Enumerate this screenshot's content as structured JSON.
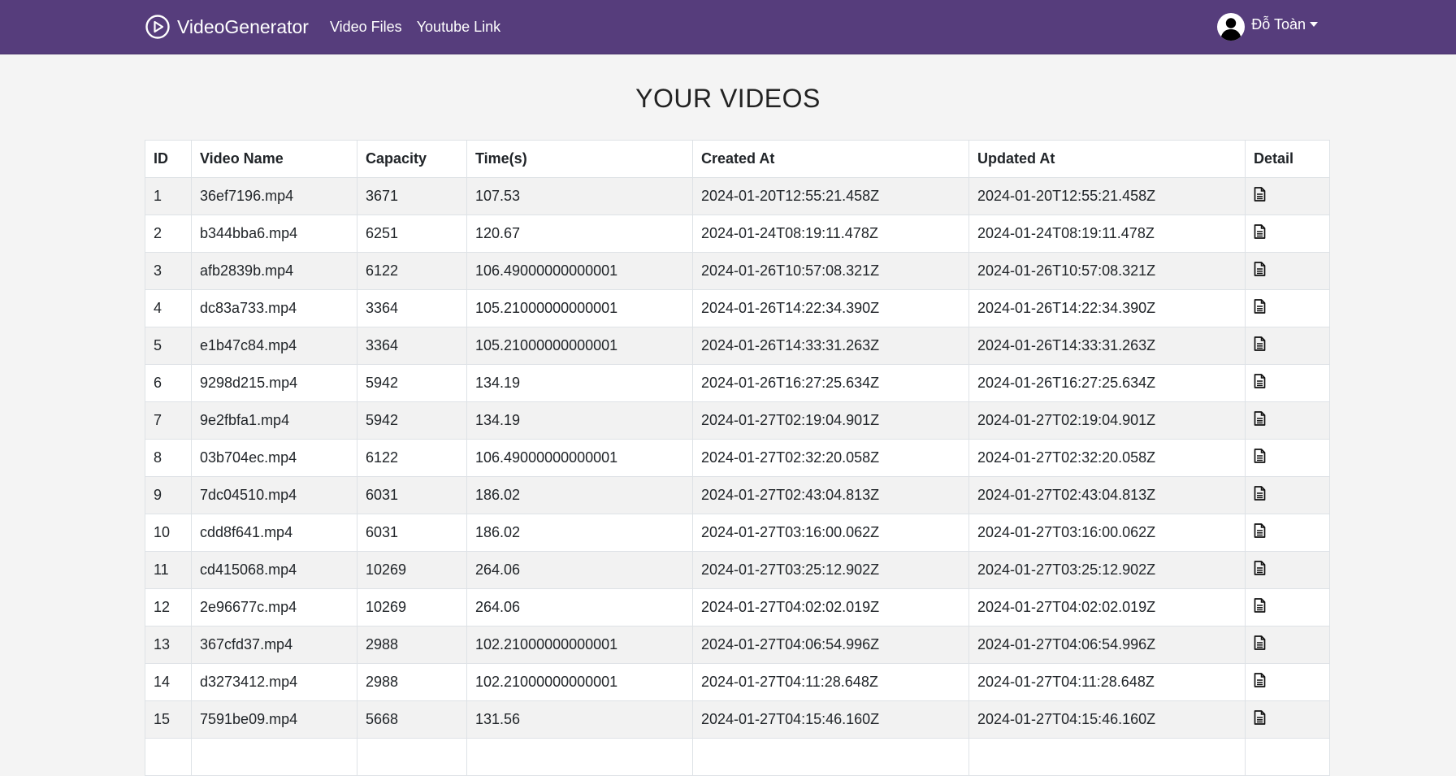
{
  "nav": {
    "brand": "VideoGenerator",
    "links": [
      "Video Files",
      "Youtube Link"
    ],
    "user_name": "Đỗ Toàn"
  },
  "page": {
    "title": "YOUR VIDEOS"
  },
  "table": {
    "headers": [
      "ID",
      "Video Name",
      "Capacity",
      "Time(s)",
      "Created At",
      "Updated At",
      "Detail"
    ],
    "rows": [
      {
        "id": "1",
        "name": "36ef7196.mp4",
        "capacity": "3671",
        "time": "107.53",
        "created": "2024-01-20T12:55:21.458Z",
        "updated": "2024-01-20T12:55:21.458Z"
      },
      {
        "id": "2",
        "name": "b344bba6.mp4",
        "capacity": "6251",
        "time": "120.67",
        "created": "2024-01-24T08:19:11.478Z",
        "updated": "2024-01-24T08:19:11.478Z"
      },
      {
        "id": "3",
        "name": "afb2839b.mp4",
        "capacity": "6122",
        "time": "106.49000000000001",
        "created": "2024-01-26T10:57:08.321Z",
        "updated": "2024-01-26T10:57:08.321Z"
      },
      {
        "id": "4",
        "name": "dc83a733.mp4",
        "capacity": "3364",
        "time": "105.21000000000001",
        "created": "2024-01-26T14:22:34.390Z",
        "updated": "2024-01-26T14:22:34.390Z"
      },
      {
        "id": "5",
        "name": "e1b47c84.mp4",
        "capacity": "3364",
        "time": "105.21000000000001",
        "created": "2024-01-26T14:33:31.263Z",
        "updated": "2024-01-26T14:33:31.263Z"
      },
      {
        "id": "6",
        "name": "9298d215.mp4",
        "capacity": "5942",
        "time": "134.19",
        "created": "2024-01-26T16:27:25.634Z",
        "updated": "2024-01-26T16:27:25.634Z"
      },
      {
        "id": "7",
        "name": "9e2fbfa1.mp4",
        "capacity": "5942",
        "time": "134.19",
        "created": "2024-01-27T02:19:04.901Z",
        "updated": "2024-01-27T02:19:04.901Z"
      },
      {
        "id": "8",
        "name": "03b704ec.mp4",
        "capacity": "6122",
        "time": "106.49000000000001",
        "created": "2024-01-27T02:32:20.058Z",
        "updated": "2024-01-27T02:32:20.058Z"
      },
      {
        "id": "9",
        "name": "7dc04510.mp4",
        "capacity": "6031",
        "time": "186.02",
        "created": "2024-01-27T02:43:04.813Z",
        "updated": "2024-01-27T02:43:04.813Z"
      },
      {
        "id": "10",
        "name": "cdd8f641.mp4",
        "capacity": "6031",
        "time": "186.02",
        "created": "2024-01-27T03:16:00.062Z",
        "updated": "2024-01-27T03:16:00.062Z"
      },
      {
        "id": "11",
        "name": "cd415068.mp4",
        "capacity": "10269",
        "time": "264.06",
        "created": "2024-01-27T03:25:12.902Z",
        "updated": "2024-01-27T03:25:12.902Z"
      },
      {
        "id": "12",
        "name": "2e96677c.mp4",
        "capacity": "10269",
        "time": "264.06",
        "created": "2024-01-27T04:02:02.019Z",
        "updated": "2024-01-27T04:02:02.019Z"
      },
      {
        "id": "13",
        "name": "367cfd37.mp4",
        "capacity": "2988",
        "time": "102.21000000000001",
        "created": "2024-01-27T04:06:54.996Z",
        "updated": "2024-01-27T04:06:54.996Z"
      },
      {
        "id": "14",
        "name": "d3273412.mp4",
        "capacity": "2988",
        "time": "102.21000000000001",
        "created": "2024-01-27T04:11:28.648Z",
        "updated": "2024-01-27T04:11:28.648Z"
      },
      {
        "id": "15",
        "name": "7591be09.mp4",
        "capacity": "5668",
        "time": "131.56",
        "created": "2024-01-27T04:15:46.160Z",
        "updated": "2024-01-27T04:15:46.160Z"
      },
      {
        "id": "",
        "name": "",
        "capacity": "",
        "time": "",
        "created": "",
        "updated": ""
      }
    ]
  },
  "colors": {
    "navbar": "#563d7c",
    "background": "#f4f4f4",
    "row_stripe": "#f2f2f2"
  },
  "icons": {
    "brand": "play-circle-icon",
    "avatar": "user-avatar-icon",
    "detail": "document-icon"
  }
}
